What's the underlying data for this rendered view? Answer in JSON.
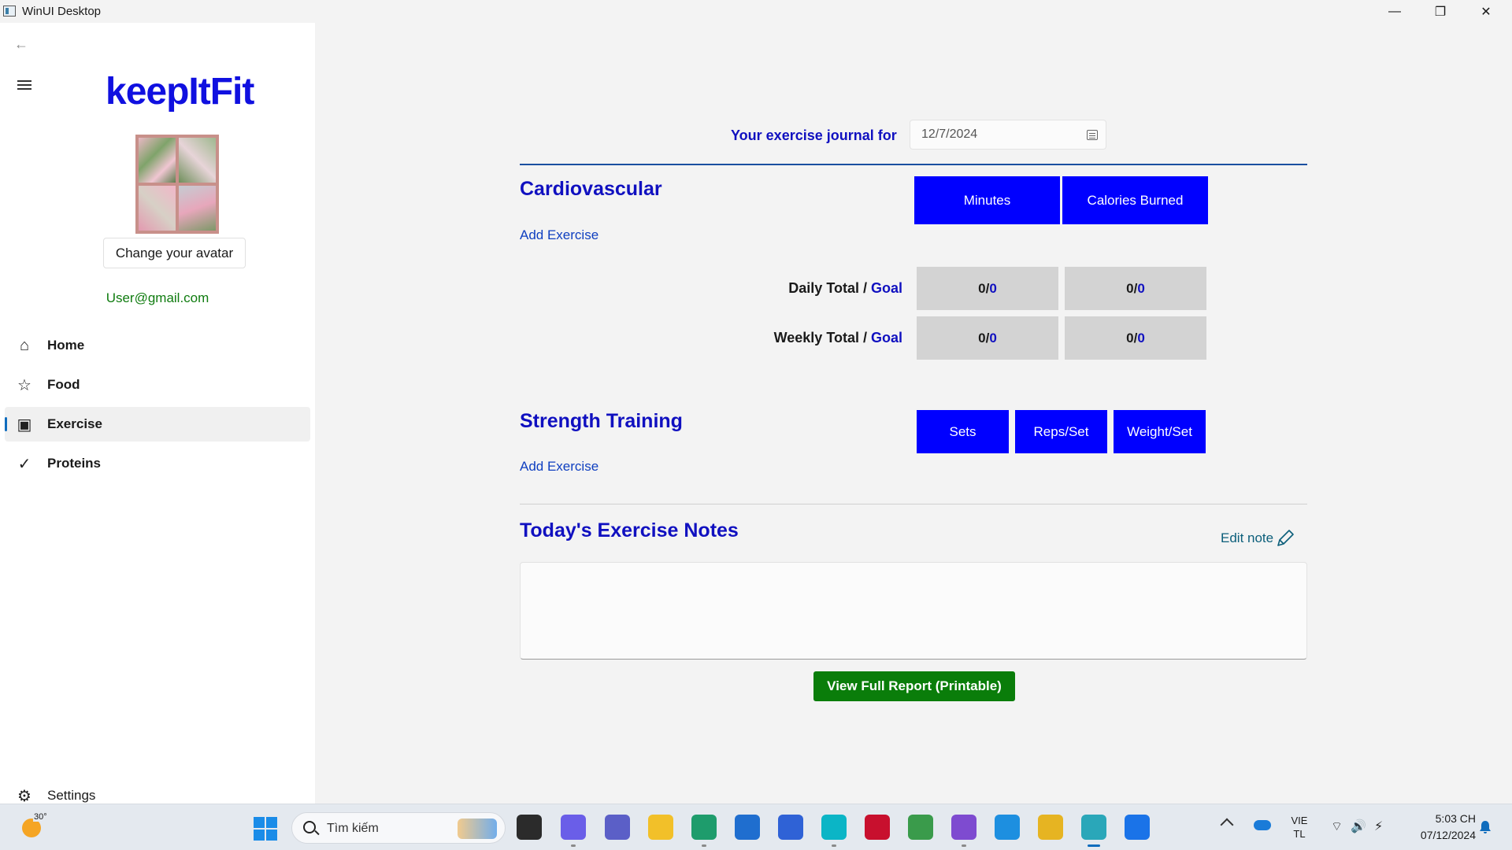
{
  "window": {
    "title": "WinUI Desktop",
    "minimize_glyph": "—",
    "maximize_glyph": "❐",
    "close_glyph": "✕"
  },
  "sidebar": {
    "back_glyph": "←",
    "logo": "keepItFit",
    "avatar_button": "Change your avatar",
    "email": "User@gmail.com",
    "items": [
      {
        "label": "Home",
        "icon": "home-icon",
        "glyph": "⌂"
      },
      {
        "label": "Food",
        "icon": "star-icon",
        "glyph": "☆"
      },
      {
        "label": "Exercise",
        "icon": "exercise-icon",
        "glyph": "▣",
        "selected": true
      },
      {
        "label": "Proteins",
        "icon": "check-icon",
        "glyph": "✓"
      }
    ],
    "settings": {
      "label": "Settings",
      "icon": "gear-icon",
      "glyph": "⚙"
    }
  },
  "journal": {
    "label": "Your exercise journal for",
    "date": "12/7/2024"
  },
  "cardio": {
    "title": "Cardiovascular",
    "add_exercise": "Add Exercise",
    "col_minutes": "Minutes",
    "col_calories": "Calories Burned",
    "daily_label": "Daily Total / ",
    "weekly_label": "Weekly Total / ",
    "goal_label": "Goal",
    "daily_minutes": "0/",
    "daily_minutes_goal": "0",
    "daily_calories": "0/",
    "daily_calories_goal": "0",
    "weekly_minutes": "0/",
    "weekly_minutes_goal": "0",
    "weekly_calories": "0/",
    "weekly_calories_goal": "0"
  },
  "strength": {
    "title": "Strength Training",
    "add_exercise": "Add Exercise",
    "col_sets": "Sets",
    "col_reps": "Reps/Set",
    "col_weight": "Weight/Set"
  },
  "notes": {
    "title": "Today's Exercise Notes",
    "edit": "Edit note",
    "content": ""
  },
  "report_button": "View Full Report (Printable)",
  "taskbar": {
    "weather_temp": "30°",
    "search_placeholder": "Tìm kiếm",
    "language_line1": "VIE",
    "language_line2": "TL",
    "time": "5:03 CH",
    "date": "07/12/2024",
    "tray_glyphs": "⌔🔊⚡",
    "apps": [
      {
        "name": "task-view",
        "color": "#2b2b2b"
      },
      {
        "name": "copilot",
        "color": "#6a5ee8"
      },
      {
        "name": "teams",
        "color": "#5b5fc7"
      },
      {
        "name": "file-explorer",
        "color": "#f2c029"
      },
      {
        "name": "edge",
        "color": "#1e9c6c"
      },
      {
        "name": "store",
        "color": "#1f6ecf"
      },
      {
        "name": "visual-studio-code-like",
        "color": "#2f62d6"
      },
      {
        "name": "cortana-circle",
        "color": "#0bb5c6"
      },
      {
        "name": "mcafee",
        "color": "#c8102e"
      },
      {
        "name": "chrome",
        "color": "#3a9b4b"
      },
      {
        "name": "visual-studio",
        "color": "#7e4bd0"
      },
      {
        "name": "docker",
        "color": "#1d8fe0"
      },
      {
        "name": "paint-tool",
        "color": "#e6b422"
      },
      {
        "name": "winui-app",
        "color": "#2aa7b9"
      },
      {
        "name": "zalo",
        "color": "#1a73e8"
      }
    ]
  },
  "colors": {
    "accent_blue": "#0000ff",
    "title_blue": "#1010c0",
    "report_green": "#0a7d0a",
    "email_green": "#107c10"
  }
}
